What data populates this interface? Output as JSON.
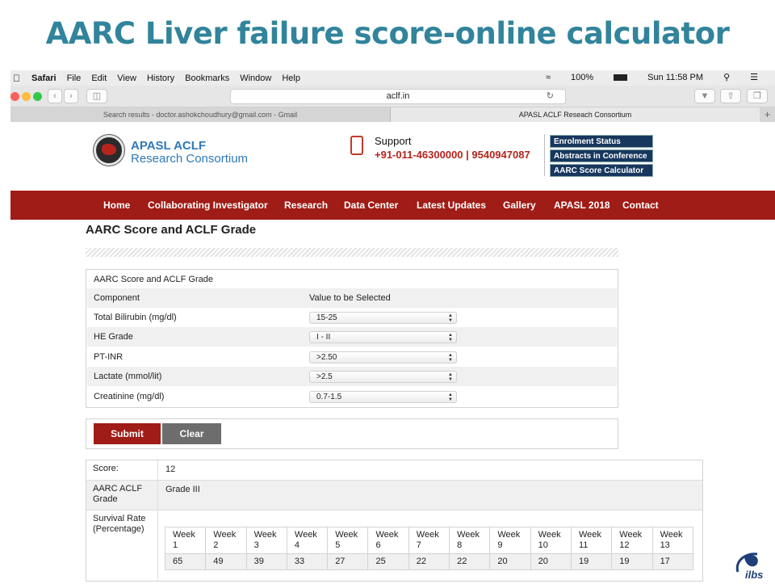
{
  "slide_title": "AARC Liver failure score-online calculator",
  "menubar": {
    "app": "Safari",
    "items": [
      "File",
      "Edit",
      "View",
      "History",
      "Bookmarks",
      "Window",
      "Help"
    ],
    "battery": "100%",
    "clock": "Sun 11:58 PM"
  },
  "browser": {
    "url": "aclf.in",
    "tabs": [
      "Search results - doctor.ashokchoudhury@gmail.com - Gmail",
      "APASL ACLF Reseach Consortium"
    ]
  },
  "header": {
    "brand_line1": "APASL ACLF",
    "brand_line2": "Research Consortium",
    "support_label": "Support",
    "support_phone": "+91-011-46300000 | 9540947087",
    "quick_links": [
      "Enrolment Status",
      "Abstracts in Conference",
      "AARC Score Calculator"
    ]
  },
  "nav": [
    "Home",
    "Collaborating Investigator",
    "Research",
    "Data Center",
    "Latest Updates",
    "Gallery",
    "APASL 2018",
    "Contact"
  ],
  "page": {
    "heading": "AARC Score and ACLF Grade",
    "form_title": "AARC Score and ACLF Grade",
    "col_component": "Component",
    "col_value": "Value to be Selected",
    "fields": [
      {
        "label": "Total Bilirubin (mg/dl)",
        "value": "15-25"
      },
      {
        "label": "HE Grade",
        "value": "I - II"
      },
      {
        "label": "PT-INR",
        "value": ">2.50"
      },
      {
        "label": "Lactate (mmol/lit)",
        "value": ">2.5"
      },
      {
        "label": "Creatinine (mg/dl)",
        "value": "0.7-1.5"
      }
    ],
    "submit_label": "Submit",
    "clear_label": "Clear",
    "score_label": "Score:",
    "score_value": "12",
    "grade_label": "AARC ACLF Grade",
    "grade_value": "Grade III",
    "survival_label": "Survival Rate (Percentage)",
    "weeks": [
      "Week 1",
      "Week 2",
      "Week 3",
      "Week 4",
      "Week 5",
      "Week 6",
      "Week 7",
      "Week 8",
      "Week 9",
      "Week 10",
      "Week 11",
      "Week 12",
      "Week 13"
    ],
    "survival": [
      "65",
      "49",
      "39",
      "33",
      "27",
      "25",
      "22",
      "22",
      "20",
      "20",
      "19",
      "19",
      "17"
    ]
  },
  "footer_logo": "ilbs",
  "colors": {
    "title": "#31849b",
    "nav": "#a01c16",
    "submit": "#a01c16",
    "clear": "#6d6d6d",
    "quicklink": "#17375e"
  }
}
